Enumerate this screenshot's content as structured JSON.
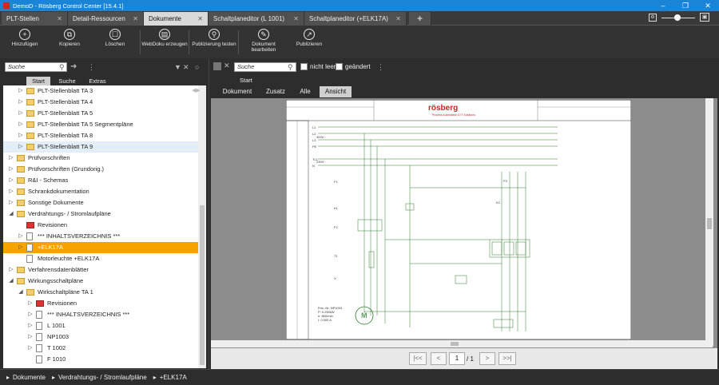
{
  "window": {
    "title": "DemoD - Rösberg Control Center [15.4.1]"
  },
  "tabs": [
    "PLT-Stellen",
    "Detail-Ressourcen",
    "Dokumente",
    "Schaltplaneditor (L 1001)",
    "Schaltplaneditor (+ELK17A)"
  ],
  "toolbar": {
    "add": "Hinzufügen",
    "copy": "Kopieren",
    "delete": "Löschen",
    "webdoku": "WebDoku erzeugen",
    "pubtest": "Publizierung testen",
    "docedit": "Dokument bearbeiten",
    "publish": "Publizieren"
  },
  "left": {
    "search_placeholder": "Suche",
    "subtabs": [
      "Start",
      "Suche",
      "Extras"
    ]
  },
  "tree": [
    {
      "label": "PLT-Stellenblatt  TA 3",
      "indent": 1,
      "icon": "folder"
    },
    {
      "label": "PLT-Stellenblatt  TA 4",
      "indent": 1,
      "icon": "folder"
    },
    {
      "label": "PLT-Stellenblatt  TA 5",
      "indent": 1,
      "icon": "folder"
    },
    {
      "label": "PLT-Stellenblatt  TA 5 Segmentpläne",
      "indent": 1,
      "icon": "folder"
    },
    {
      "label": "PLT-Stellenblatt  TA 8",
      "indent": 1,
      "icon": "folder"
    },
    {
      "label": "PLT-Stellenblatt  TA 9",
      "indent": 1,
      "icon": "folder",
      "state": "hl"
    },
    {
      "label": "Prüfvorschriften",
      "indent": 0,
      "icon": "folder"
    },
    {
      "label": "Prüfvorschriften (Grundorig.)",
      "indent": 0,
      "icon": "folder"
    },
    {
      "label": "R&I - Schemas",
      "indent": 0,
      "icon": "folder"
    },
    {
      "label": "Schrankdokumentation",
      "indent": 0,
      "icon": "folder"
    },
    {
      "label": "Sonstige Dokumente",
      "indent": 0,
      "icon": "folder"
    },
    {
      "label": "Verdrahtungs- / Stromlaufpläne",
      "indent": 0,
      "icon": "folder",
      "open": true
    },
    {
      "label": "Revisionen",
      "indent": 1,
      "icon": "rev",
      "noexp": true
    },
    {
      "label": "*** INHALTSVERZEICHNIS ***",
      "indent": 1,
      "icon": "doc"
    },
    {
      "label": "+ELK17A",
      "indent": 1,
      "icon": "doc",
      "state": "sel"
    },
    {
      "label": "Motorleuchte  +ELK17A",
      "indent": 1,
      "icon": "doc",
      "noexp": true
    },
    {
      "label": "Verfahrensdatenblätter",
      "indent": 0,
      "icon": "folder"
    },
    {
      "label": "Wirkungsschaltpläne",
      "indent": 0,
      "icon": "folder",
      "open": true
    },
    {
      "label": "Wirkschaltpläne  TA 1",
      "indent": 1,
      "icon": "folder",
      "open": true
    },
    {
      "label": "Revisionen",
      "indent": 2,
      "icon": "rev"
    },
    {
      "label": "*** INHALTSVERZEICHNIS ***",
      "indent": 2,
      "icon": "doc"
    },
    {
      "label": "L 1001",
      "indent": 2,
      "icon": "doc"
    },
    {
      "label": "NP1003",
      "indent": 2,
      "icon": "doc"
    },
    {
      "label": "T 1002",
      "indent": 2,
      "icon": "doc"
    },
    {
      "label": "F 1010",
      "indent": 2,
      "icon": "doc",
      "noexp": true
    }
  ],
  "right": {
    "search_placeholder": "Suche",
    "nicht_leer": "nicht leer",
    "geaendert": "geändert",
    "start": "Start",
    "viewtabs": [
      "Dokument",
      "Zusatz",
      "Alle",
      "Ansicht"
    ]
  },
  "doc": {
    "brand": "rösberg",
    "subtitle": "Process Automation & IT Solutions",
    "rail_labels": [
      "L1",
      "L2",
      "L3",
      "PE",
      "TL1",
      "N"
    ],
    "voltage1": "400V~",
    "voltage2": "230V~",
    "motor": "M",
    "component_labels": [
      "F1",
      "K1",
      "F2",
      "T1",
      "F3",
      "K2",
      "X"
    ],
    "data_block": [
      "Pos.-Nr: NP1003",
      "P:    0.250kW",
      "n:    860/min",
      "I:    0.500 A"
    ]
  },
  "pager": {
    "first": "|<<",
    "prev": "<",
    "page": "1",
    "total": "/ 1",
    "next": ">",
    "last": ">>|"
  },
  "status": {
    "crumbs": [
      "Dokumente",
      "Verdrahtungs- / Stromlaufpläne",
      "+ELK17A"
    ]
  }
}
